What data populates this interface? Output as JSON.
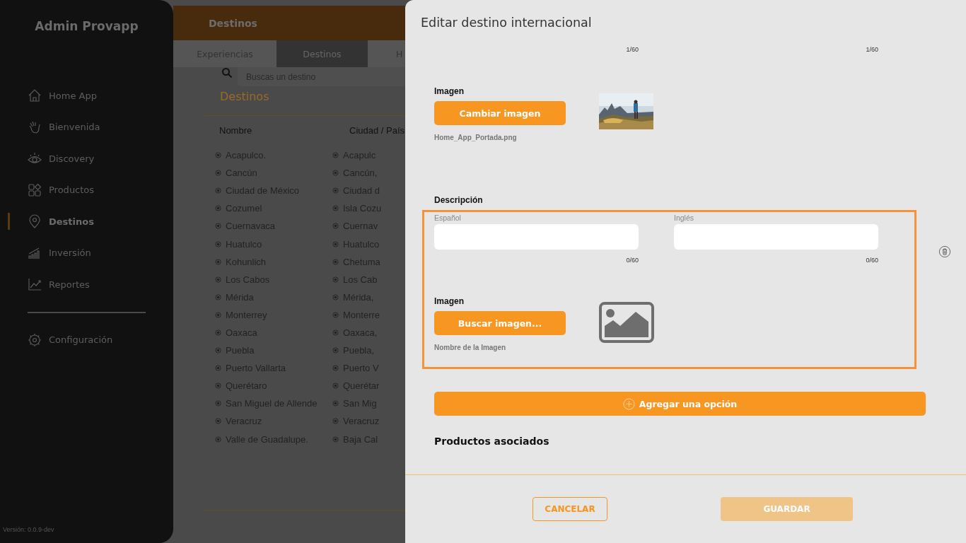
{
  "sidebar": {
    "title": "Admin Provapp",
    "items": [
      {
        "label": "Home App",
        "selected": false
      },
      {
        "label": "Bienvenida",
        "selected": false
      },
      {
        "label": "Discovery",
        "selected": false
      },
      {
        "label": "Productos",
        "selected": false
      },
      {
        "label": "Destinos",
        "selected": true
      },
      {
        "label": "Inversión",
        "selected": false
      },
      {
        "label": "Reportes",
        "selected": false
      }
    ],
    "settings": {
      "label": "Configuración"
    },
    "version": "Versión: 0.0.9-dev"
  },
  "page": {
    "title": "Destinos",
    "tabs": [
      {
        "label": "Experiencias",
        "selected": false
      },
      {
        "label": "Destinos",
        "selected": true
      },
      {
        "label": "H",
        "selected": false
      }
    ],
    "search": {
      "placeholder": "Buscas un destino"
    },
    "section_title": "Destinos",
    "table": {
      "columns": [
        "Nombre",
        "Ciudad / País"
      ],
      "rows": [
        [
          "Acapulco.",
          "Acapulc"
        ],
        [
          "Cancún",
          "Cancún,"
        ],
        [
          "Ciudad de México",
          "Ciudad d"
        ],
        [
          "Cozumel",
          "Isla Cozu"
        ],
        [
          "Cuernavaca",
          "Cuernav"
        ],
        [
          "Huatulco",
          "Huatulco"
        ],
        [
          "Kohunlich",
          "Chetuma"
        ],
        [
          "Los Cabos",
          "Los Cab"
        ],
        [
          "Mérida",
          "Mérida,"
        ],
        [
          "Monterrey",
          "Monterre"
        ],
        [
          "Oaxaca",
          "Oaxaca,"
        ],
        [
          "Puebla",
          "Puebla,"
        ],
        [
          "Puerto Vallarta",
          "Puerto V"
        ],
        [
          "Querétaro",
          "Querétar"
        ],
        [
          "San Miguel de Allende",
          "San Mig"
        ],
        [
          "Veracruz",
          "Veracruz"
        ],
        [
          "Valle de Guadalupe.",
          "Baja Cal"
        ]
      ]
    }
  },
  "panel": {
    "title": "Editar destino internacional",
    "counters_top": [
      "1/60",
      "1/60"
    ],
    "image_block": {
      "label": "Imagen",
      "button": "Cambiar imagen",
      "filename": "Home_App_Portada.png",
      "kind": "picture"
    },
    "description": {
      "label": "Descripción",
      "option": {
        "fields": [
          {
            "label": "Español",
            "counter": "0/60"
          },
          {
            "label": "Inglés",
            "counter": "0/60"
          }
        ],
        "image_label": "Imagen",
        "button": "Buscar imagen...",
        "filename": "Nombre de la Imagen"
      }
    },
    "add_option": "Agregar una opción",
    "products_title": "Productos asociados",
    "footer": {
      "cancel": {
        "label": "CANCELAR"
      },
      "save": {
        "label": "GUARDAR",
        "disabled": true
      }
    }
  }
}
